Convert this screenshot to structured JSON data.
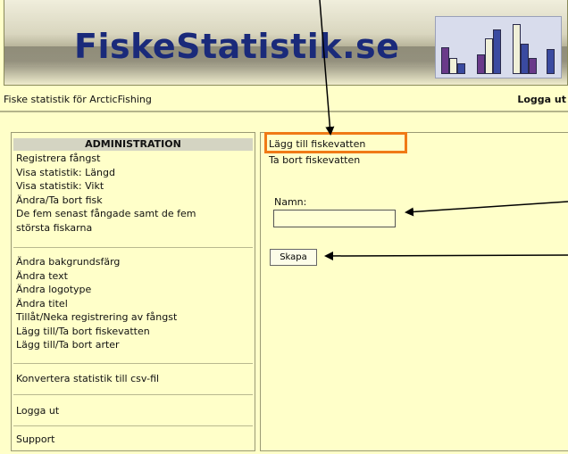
{
  "header": {
    "title": "FiskeStatistik.se",
    "subtitle": "Fiske statistik för ArcticFishing",
    "logout": "Logga ut"
  },
  "sidebar": {
    "heading": "ADMINISTRATION",
    "group1": [
      "Registrera fångst",
      "Visa statistik: Längd",
      "Visa statistik: Vikt",
      "Ändra/Ta bort fisk",
      "De fem senast fångade samt de fem",
      "största fiskarna"
    ],
    "group2": [
      "Ändra bakgrundsfärg",
      "Ändra text",
      "Ändra logotype",
      "Ändra titel",
      "Tillåt/Neka registrering av fångst",
      "Lägg till/Ta bort fiskevatten",
      "Lägg till/Ta bort arter"
    ],
    "convert": "Konvertera statistik till csv-fil",
    "logout": "Logga ut",
    "support": "Support"
  },
  "main": {
    "add_water": "Lägg till fiskevatten",
    "remove_water": "Ta bort fiskevatten",
    "name_label": "Namn:",
    "name_value": "",
    "create_button": "Skapa"
  },
  "colors": {
    "background": "#ffffc9",
    "highlight": "#f07a16",
    "title": "#1a2a7a"
  }
}
